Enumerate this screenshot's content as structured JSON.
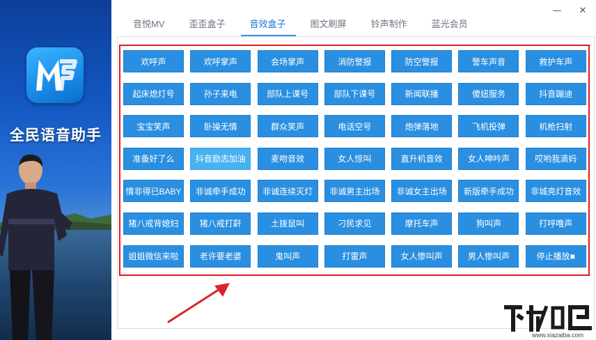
{
  "app": {
    "name": "全民语音助手"
  },
  "tabs": [
    {
      "label": "音悦MV"
    },
    {
      "label": "歪歪盒子"
    },
    {
      "label": "音效盒子"
    },
    {
      "label": "图文刷屏"
    },
    {
      "label": "铃声制作"
    },
    {
      "label": "蓝光会员"
    }
  ],
  "active_tab": "音效盒子",
  "window": {
    "minimize": "—",
    "close": "✕"
  },
  "sound_buttons": [
    [
      "欢呼声",
      "欢呼掌声",
      "会场掌声",
      "消防警报",
      "防空警报",
      "警车声音",
      "救护车声"
    ],
    [
      "起床熄灯号",
      "孙子来电",
      "部队上课号",
      "部队下课号",
      "新闻联播",
      "傻妞服务",
      "抖音蹦迪"
    ],
    [
      "宝宝笑声",
      "卧操无情",
      "群众笑声",
      "电话空号",
      "炮弹落地",
      "飞机投弹",
      "机枪扫射"
    ],
    [
      "准备好了么",
      "抖音励志加油",
      "麦吻音效",
      "女人惊叫",
      "直升机音效",
      "女人呻吟声",
      "哎哟我滴妈"
    ],
    [
      "情非得已BABY",
      "非诚牵手成功",
      "非诚连续灭灯",
      "非诚男主出场",
      "非诚女主出场",
      "新版牵手成功",
      "非城亮灯音效"
    ],
    [
      "猪八戒背媳妇",
      "猪八戒打鼾",
      "土拨鼠叫",
      "刁民求见",
      "摩托车声",
      "狗叫声",
      "打呼噜声"
    ],
    [
      "姐姐微信来啦",
      "老许要老婆",
      "鬼叫声",
      "打雷声",
      "女人惨叫声",
      "男人惨叫声",
      "停止播放■"
    ]
  ],
  "hovered_button": "抖音励志加油",
  "colors": {
    "button_bg": "#2a8fe0",
    "button_hover_bg": "#48b1ef",
    "highlight_border": "#e0191c",
    "active_tab": "#1a73d8"
  },
  "watermark": {
    "url": "www.xiazaiba.com"
  }
}
